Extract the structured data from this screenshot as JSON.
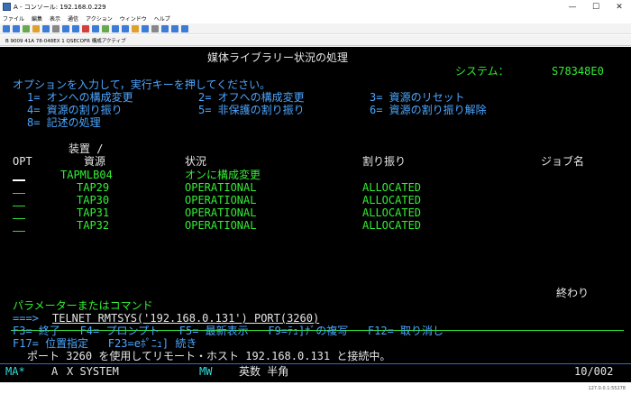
{
  "window": {
    "title": "A - コンソール: 192.168.0.229",
    "min": "—",
    "max": "☐",
    "close": "✕"
  },
  "menu": [
    "ファイル",
    "編集",
    "表示",
    "通信",
    "アクション",
    "ウィンドウ",
    "ヘルプ"
  ],
  "toolbar_colors": [
    "#3c7bd6",
    "#3c7bd6",
    "#6aa84f",
    "#e0a030",
    "#3c7bd6",
    "#888888",
    "#3c7bd6",
    "#3c7bd6",
    "#d04040",
    "#3c7bd6",
    "#6aa84f",
    "#3c7bd6",
    "#3c7bd6",
    "#e0a030",
    "#3c7bd6",
    "#888888",
    "#3c7bd6",
    "#3c7bd6",
    "#3c7bd6"
  ],
  "session_status": "B 9009 41A 78-048EX 1 QSECOFR    構成アクティブ",
  "screen": {
    "title": "媒体ライブラリー状況の処理",
    "system_label": "システム：",
    "system_name": "S78348E0",
    "instruction": "オプションを入力して，実行キーを押してください。",
    "options": [
      "1= オンへの構成変更",
      "2= オフへの構成変更",
      "3= 資源のリセット",
      "4= 資源の割り振り",
      "5= 非保護の割り振り",
      "6= 資源の割り振り解除",
      "8= 記述の処理"
    ],
    "headers": {
      "device": "装置 /",
      "opt": "OPT",
      "resource": "資源",
      "status": "状況",
      "allocation": "割り振り",
      "job": "ジョブ名"
    },
    "rows": [
      {
        "name": "TAPMLB04",
        "status": "オンに構成変更",
        "alloc": ""
      },
      {
        "name": "TAP29",
        "status": "OPERATIONAL",
        "alloc": "ALLOCATED"
      },
      {
        "name": "TAP30",
        "status": "OPERATIONAL",
        "alloc": "ALLOCATED"
      },
      {
        "name": "TAP31",
        "status": "OPERATIONAL",
        "alloc": "ALLOCATED"
      },
      {
        "name": "TAP32",
        "status": "OPERATIONAL",
        "alloc": "ALLOCATED"
      }
    ],
    "more": "終わり",
    "param_label": "パラメーターまたはコマンド",
    "prompt": "===>",
    "command": "TELNET RMTSYS('192.168.0.131') PORT(3260)",
    "fkeys_line1": "F3= 終了   F4= プロンプト   F5= 最新表示   F9=ﾃｭ]ﾅﾞの複写   F12= 取り消し",
    "fkeys_line2": "F17= 位置指定   F23=eﾎﾟﾆｭ] 続き",
    "message": "ポート 3260 を使用してリモート・ホスト 192.168.0.131 と接続中。"
  },
  "oia": {
    "ma": "MA*",
    "a": "A",
    "x": "X SYSTEM",
    "mw": "MW",
    "mode": "英数 半角",
    "pos": "10/002"
  },
  "os_status": "127.0.0.1:55278"
}
